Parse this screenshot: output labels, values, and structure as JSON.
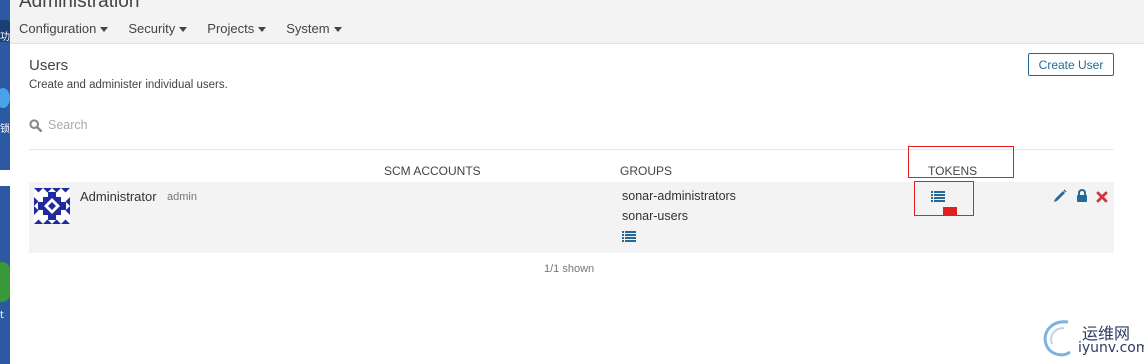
{
  "header": {
    "title": "Administration",
    "nav": [
      "Configuration",
      "Security",
      "Projects",
      "System"
    ]
  },
  "page": {
    "title": "Users",
    "description": "Create and administer individual users.",
    "create_button": "Create User"
  },
  "search": {
    "placeholder": "Search"
  },
  "table": {
    "columns": {
      "scm": "SCM ACCOUNTS",
      "groups": "GROUPS",
      "tokens": "TOKENS"
    },
    "rows": [
      {
        "name": "Administrator",
        "login": "admin",
        "groups": [
          "sonar-administrators",
          "sonar-users"
        ]
      }
    ],
    "footer": "1/1 shown"
  },
  "colors": {
    "accent": "#236a97",
    "delete": "#d4333f",
    "annotation": "#e02020"
  },
  "icons": [
    "search-icon",
    "list-icon",
    "pencil-icon",
    "lock-icon",
    "close-icon",
    "chevron-down-icon"
  ],
  "watermark": {
    "cn": "运维网",
    "en": "iyunv.com"
  },
  "desktop_strip": {
    "labels": [
      "功",
      "锁",
      "t"
    ]
  }
}
